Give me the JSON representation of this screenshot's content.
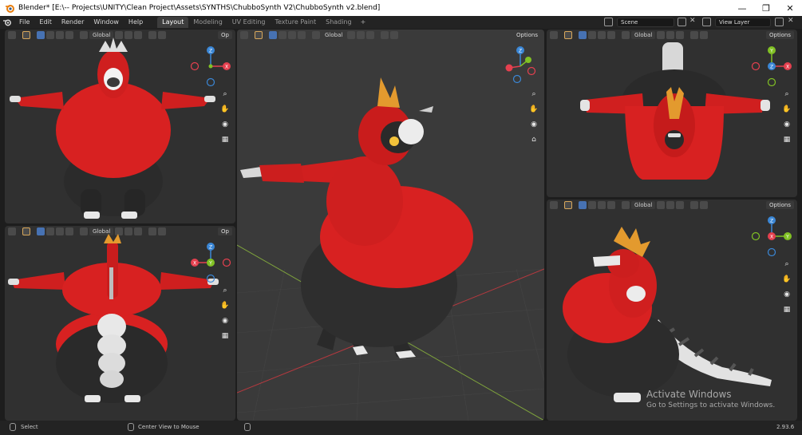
{
  "window": {
    "title": "Blender* [E:\\-- Projects\\UNITY\\Clean Project\\Assets\\SYNTHS\\ChubboSynth V2\\ChubboSynth v2.blend]",
    "minimize": "—",
    "maximize": "❐",
    "close": "✕"
  },
  "menu": [
    "File",
    "Edit",
    "Render",
    "Window",
    "Help"
  ],
  "workspaces": [
    "Layout",
    "Modeling",
    "UV Editing",
    "Texture Paint",
    "Shading"
  ],
  "active_workspace": "Layout",
  "workspace_add": "+",
  "scene": {
    "name": "Scene"
  },
  "view_layer": {
    "name": "View Layer"
  },
  "viewports": {
    "top_left": {
      "orientation": "Global",
      "options": "Op",
      "gizmo_axes": "front"
    },
    "bottom_left": {
      "orientation": "Global",
      "options": "Op",
      "gizmo_axes": "back"
    },
    "center": {
      "orientation": "Global",
      "options": "Options",
      "gizmo_axes": "perspective"
    },
    "top_right": {
      "orientation": "Global",
      "options": "Options",
      "gizmo_axes": "top"
    },
    "bottom_right": {
      "orientation": "Global",
      "options": "Options",
      "gizmo_axes": "side"
    }
  },
  "axis_labels": {
    "x": "X",
    "y": "Y",
    "z": "Z"
  },
  "colors": {
    "axis_x": "#e5404f",
    "axis_y": "#81c124",
    "axis_z": "#3b87d6",
    "body_red": "#d82121",
    "body_dark": "#2a2a2a",
    "viewport_bg": "#303030",
    "active_tab": "#3d3d3d"
  },
  "statusbar": {
    "left": "Select",
    "middle": "Center View to Mouse",
    "version": "2.93.6"
  },
  "watermark": {
    "line1": "Activate Windows",
    "line2": "Go to Settings to activate Windows."
  }
}
